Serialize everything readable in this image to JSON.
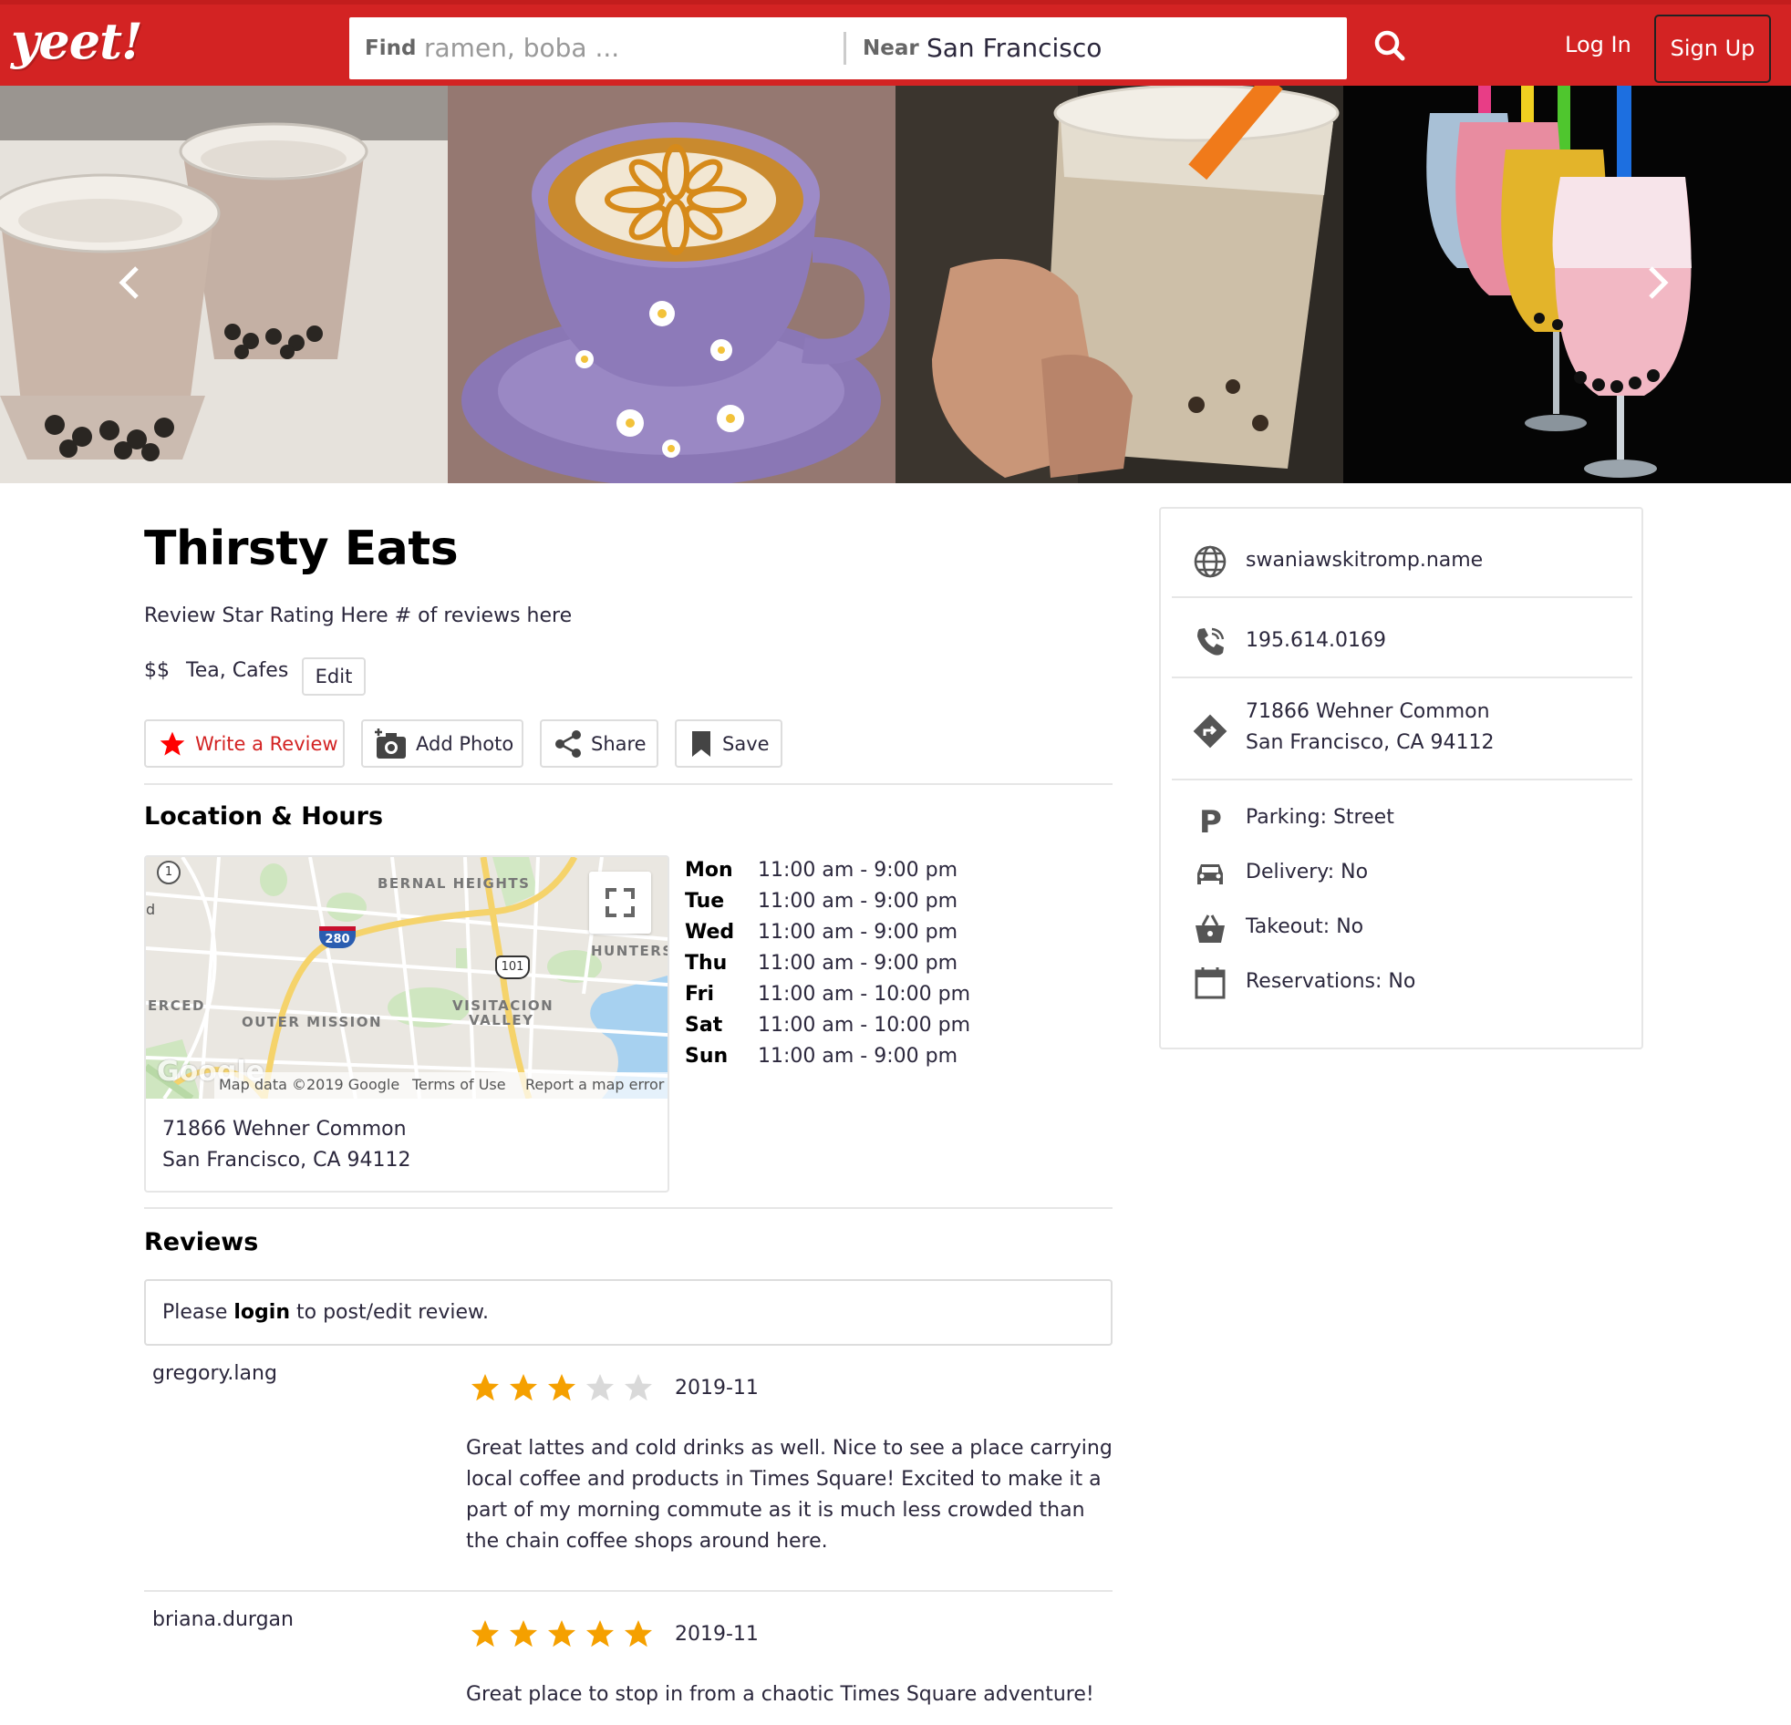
{
  "header": {
    "logo": "yeet!",
    "find_label": "Find",
    "find_placeholder": "ramen, boba ...",
    "near_label": "Near",
    "near_value": "San Francisco",
    "login": "Log In",
    "signup": "Sign Up"
  },
  "colors": {
    "brand": "#d32323",
    "star": "#f5a000",
    "star_empty": "#d9d9d9"
  },
  "business": {
    "name": "Thirsty Eats",
    "rating_placeholder": "Review Star Rating Here",
    "count_placeholder": "# of reviews here",
    "price": "$$",
    "categories": "Tea, Cafes",
    "edit": "Edit"
  },
  "actions": {
    "write_review": "Write a Review",
    "add_photo": "Add Photo",
    "share": "Share",
    "save": "Save"
  },
  "location": {
    "heading": "Location & Hours",
    "address_line1": "71866 Wehner Common",
    "address_line2": "San Francisco, CA 94112",
    "map": {
      "labels": [
        "BERNAL HEIGHTS",
        "HUNTERS",
        "ERCED",
        "OUTER MISSION",
        "VISITACION",
        "VALLEY"
      ],
      "shields": [
        "1",
        "280",
        "101"
      ],
      "left_letter": "d",
      "google": "Google",
      "footer": [
        "Map data ©2019 Google",
        "Terms of Use",
        "Report a map error"
      ]
    },
    "hours": [
      {
        "day": "Mon",
        "time": "11:00 am - 9:00 pm"
      },
      {
        "day": "Tue",
        "time": "11:00 am - 9:00 pm"
      },
      {
        "day": "Wed",
        "time": "11:00 am - 9:00 pm"
      },
      {
        "day": "Thu",
        "time": "11:00 am - 9:00 pm"
      },
      {
        "day": "Fri",
        "time": "11:00 am - 10:00 pm"
      },
      {
        "day": "Sat",
        "time": "11:00 am - 10:00 pm"
      },
      {
        "day": "Sun",
        "time": "11:00 am - 9:00 pm"
      }
    ]
  },
  "reviews": {
    "heading": "Reviews",
    "login_pre": "Please ",
    "login_link": "login",
    "login_post": " to post/edit review.",
    "items": [
      {
        "user": "gregory.lang",
        "stars": 3,
        "date": "2019-11",
        "text": "Great lattes and cold drinks as well. Nice to see a place carrying local coffee and products in Times Square! Excited to make it a part of my morning commute as it is much less crowded than the chain coffee shops around here."
      },
      {
        "user": "briana.durgan",
        "stars": 5,
        "date": "2019-11",
        "text": "Great place to stop in from a chaotic Times Square adventure!"
      }
    ]
  },
  "sidebar": {
    "website": "swaniawskitromp.name",
    "phone": "195.614.0169",
    "address_line1": "71866 Wehner Common",
    "address_line2": "San Francisco, CA 94112",
    "parking": "Parking: Street",
    "delivery": "Delivery: No",
    "takeout": "Takeout: No",
    "reservations": "Reservations: No"
  }
}
